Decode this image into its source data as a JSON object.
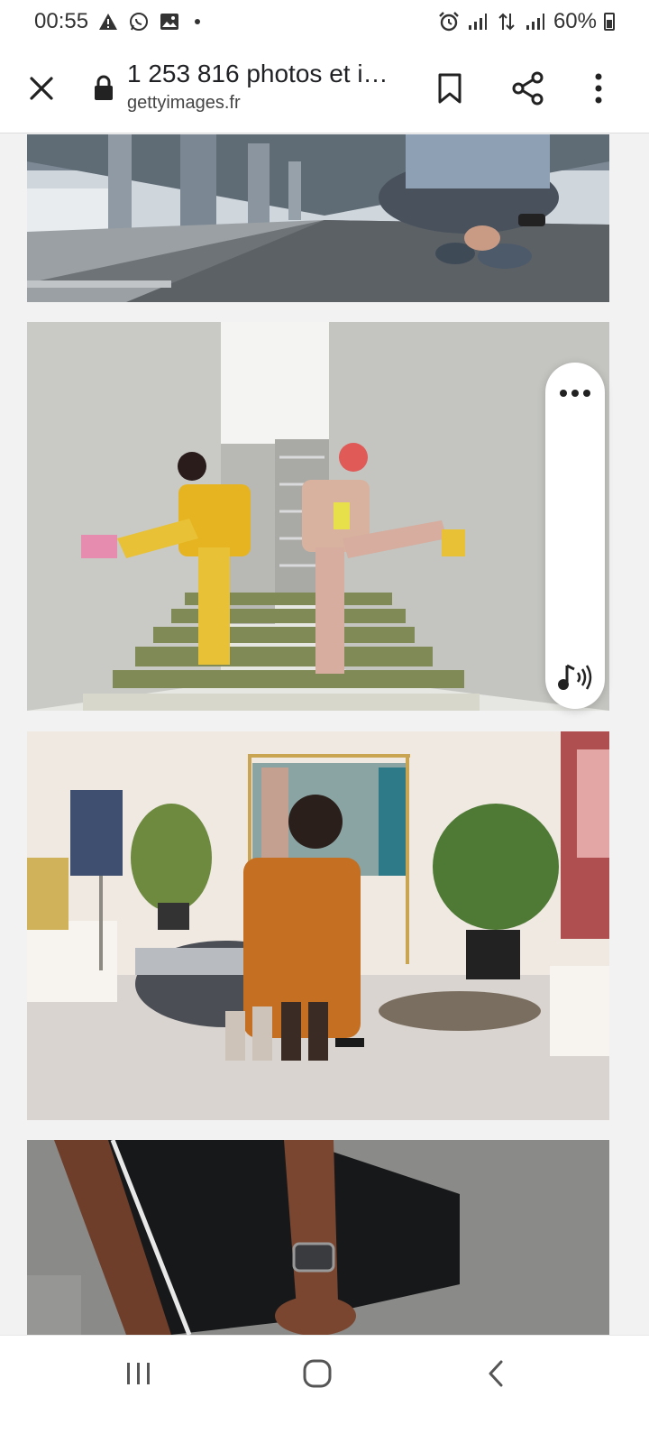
{
  "status_bar": {
    "time": "00:55",
    "battery_text": "60%",
    "icons": [
      "warning-icon",
      "whatsapp-icon",
      "gallery-icon",
      "notification-dot",
      "alarm-icon",
      "signal-icon",
      "data-transfer-icon",
      "signal-icon",
      "battery-icon"
    ]
  },
  "toolbar": {
    "title": "1 253 816 photos et i…",
    "url": "gettyimages.fr"
  },
  "photos": [
    {
      "subject": "person tying running shoe under overpass"
    },
    {
      "subject": "two women posing on concrete staircase"
    },
    {
      "subject": "woman trying on heeled shoes in boutique"
    },
    {
      "subject": "athlete adjusting shoe with smartwatch"
    }
  ],
  "side_panel": {
    "icons": [
      "more-horizontal-icon",
      "music-audio-icon"
    ]
  },
  "colors": {
    "toolbar_bg": "#ffffff",
    "page_bg": "#f2f2f2",
    "icon": "#222222"
  }
}
